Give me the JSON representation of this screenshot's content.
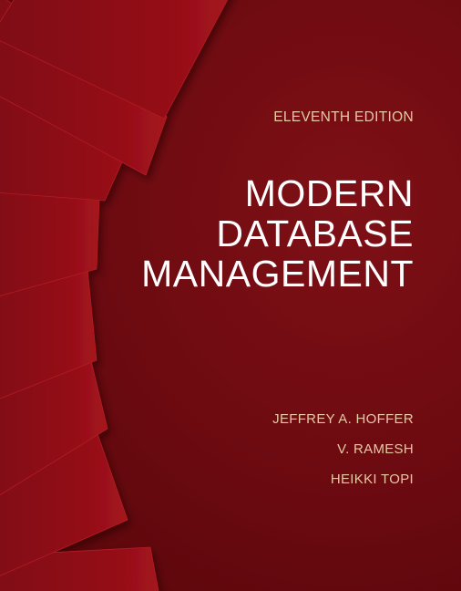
{
  "cover": {
    "edition": "ELEVENTH EDITION",
    "title_lines": [
      "MODERN",
      "DATABASE",
      "MANAGEMENT"
    ],
    "authors": [
      "JEFFREY A. HOFFER",
      "V. RAMESH",
      "HEIKKI TOPI"
    ]
  },
  "colors": {
    "background": "#6e0a10",
    "page": "#8c0f17",
    "page_edge": "#b01a22",
    "title_text": "#ffffff",
    "accent_text": "#e6c9a4"
  }
}
